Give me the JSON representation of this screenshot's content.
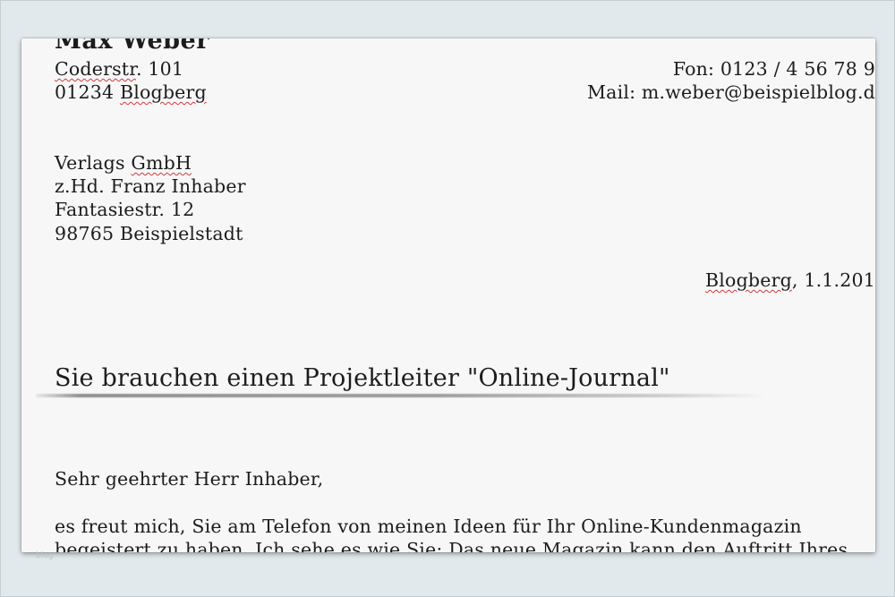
{
  "sender": {
    "name": "Max Weber",
    "street_word": "Coderstr",
    "street_rest": ". 101",
    "zip": "01234 ",
    "city": "Blogberg",
    "phone": "Fon: 0123 / 4 56 78 9",
    "email": "Mail: m.weber@beispielblog.d"
  },
  "recipient": {
    "company_word": "Verlags ",
    "company_suffix": "GmbH",
    "attention": "z.Hd. Franz Inhaber",
    "street": "Fantasiestr.  12",
    "city_line": "98765 Beispielstadt"
  },
  "date": {
    "place": "Blogberg",
    "rest": ", 1.1.201"
  },
  "subject": "Sie brauchen einen Projektleiter \"Online-Journal\"",
  "body": {
    "salutation": "Sehr geehrter Herr Inhaber,",
    "line1": "es freut mich, Sie am Telefon von meinen Ideen für Ihr Online-Kundenmagazin",
    "line2": "begeistert zu haben. Ich sehe es wie Sie: Das neue Magazin kann den Auftritt Ihres"
  },
  "watermark": "blog"
}
